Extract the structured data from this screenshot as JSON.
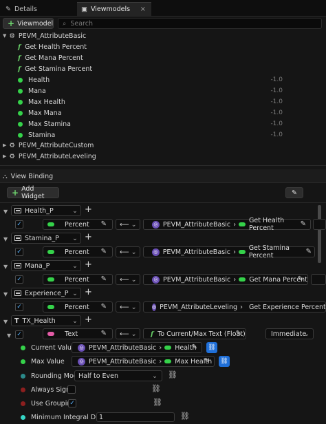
{
  "tabs": [
    {
      "label": "Details"
    },
    {
      "label": "Viewmodels",
      "close": "×"
    }
  ],
  "toolbar": {
    "add_viewmodel": "Viewmodel",
    "search_placeholder": "Search"
  },
  "viewmodels": {
    "basic": {
      "name": "PEVM_AttributeBasic",
      "functions": [
        "Get Health Percent",
        "Get Mana Percent",
        "Get Stamina Percent"
      ],
      "properties": [
        {
          "name": "Health",
          "value": "-1.0"
        },
        {
          "name": "Mana",
          "value": "-1.0"
        },
        {
          "name": "Max Health",
          "value": "-1.0"
        },
        {
          "name": "Max Mana",
          "value": "-1.0"
        },
        {
          "name": "Max Stamina",
          "value": "-1.0"
        },
        {
          "name": "Stamina",
          "value": "-1.0"
        }
      ]
    },
    "others": [
      "PEVM_AttributeCustom",
      "PEVM_AttributeLeveling"
    ]
  },
  "view_binding": {
    "title": "View Binding",
    "add_widget": "Add Widget",
    "widgets": [
      {
        "name": "Health_P",
        "prop": "Percent",
        "vm": "PEVM_AttributeBasic",
        "fn": "Get Health Percent"
      },
      {
        "name": "Stamina_P",
        "prop": "Percent",
        "vm": "PEVM_AttributeBasic",
        "fn": "Get Stamina Percent"
      },
      {
        "name": "Mana_P",
        "prop": "Percent",
        "vm": "PEVM_AttributeBasic",
        "fn": "Get Mana Percent"
      },
      {
        "name": "Experience_P",
        "prop": "Percent",
        "vm": "PEVM_AttributeLeveling",
        "fn": "Get Experience Percent"
      }
    ],
    "tx": {
      "name": "TX_Health",
      "prop": "Text",
      "conversion": "To Current/Max Text (Float)",
      "mode": "Immediate",
      "args": {
        "current_label": "Current Value",
        "current_vm": "PEVM_AttributeBasic",
        "current_prop": "Health",
        "max_label": "Max Value",
        "max_vm": "PEVM_AttributeBasic",
        "max_prop": "Max Health",
        "rounding_label": "Rounding Mode",
        "rounding_value": "Half to Even",
        "always_sign_label": "Always Sign",
        "grouping_label": "Use Grouping",
        "min_digits_label": "Minimum Integral Digits",
        "min_digits_value": "1"
      }
    }
  },
  "colors": {
    "accent": "#1f6fd8",
    "green": "#35d24a",
    "vm": "#6a4fb5",
    "bg": "#151515"
  }
}
